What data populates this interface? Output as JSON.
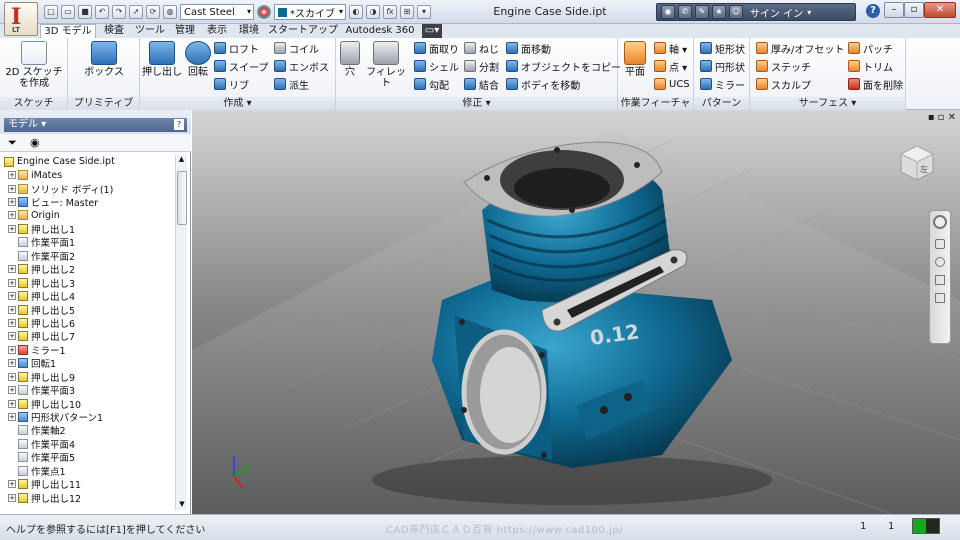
{
  "app": {
    "logo_letter": "I",
    "logo_sub": "LT",
    "doc_title": "Engine Case Side.ipt",
    "signin": "サイン イン",
    "help": "?"
  },
  "qat": {
    "material": "Cast Steel",
    "appearance": "*スカイブ",
    "fx": "fx"
  },
  "tabs": [
    "3D モデル",
    "検査",
    "ツール",
    "管理",
    "表示",
    "環境",
    "スタートアップ",
    "Autodesk 360"
  ],
  "ribbon": {
    "sketch": {
      "label": "スケッチ",
      "btn": [
        "2D スケッチ",
        "を作成"
      ]
    },
    "primitive": {
      "label": "プリミティブ",
      "btn": "ボックス"
    },
    "create": {
      "label": "作成 ▾",
      "extrude": "押し出し",
      "revolve": "回転",
      "loft": "ロフト",
      "sweep": "スイープ",
      "rib": "リブ",
      "coil": "コイル",
      "emboss": "エンボス",
      "derive": "派生"
    },
    "modify": {
      "label": "修正 ▾",
      "hole": "穴",
      "fillet": "フィレット",
      "chamfer": "面取り",
      "shell": "シェル",
      "draft": "勾配",
      "thread": "ねじ",
      "split": "分割",
      "combine": "結合",
      "face_move": "面移動",
      "copy_obj": "オブジェクトをコピー",
      "move_body": "ボディを移動"
    },
    "workfeature": {
      "label": "作業フィーチャ",
      "plane": "平面",
      "axis": "軸 ▾",
      "point": "点 ▾",
      "ucs": "UCS"
    },
    "pattern": {
      "label": "パターン",
      "rect": "矩形状",
      "circ": "円形状",
      "mirror": "ミラー"
    },
    "surface": {
      "label": "サーフェス ▾",
      "thicken": "厚み/オフセット",
      "stitch": "ステッチ",
      "sculpt": "スカルプ",
      "patch": "パッチ",
      "trim": "トリム",
      "delete_face": "面を削除"
    }
  },
  "browser": {
    "title": "モデル ▾",
    "items": [
      {
        "label": "Engine Case Side.ipt",
        "icon": "part",
        "expand": ""
      },
      {
        "label": "iMates",
        "icon": "folder",
        "expand": "+"
      },
      {
        "label": "ソリッド ボディ(1)",
        "icon": "folder",
        "expand": "+"
      },
      {
        "label": "ビュー: Master",
        "icon": "blue",
        "expand": "+"
      },
      {
        "label": "Origin",
        "icon": "folder",
        "expand": "+"
      },
      {
        "label": "押し出し1",
        "icon": "part",
        "expand": "+"
      },
      {
        "label": "作業平面1",
        "icon": "plane",
        "expand": ""
      },
      {
        "label": "作業平面2",
        "icon": "plane",
        "expand": ""
      },
      {
        "label": "押し出し2",
        "icon": "part",
        "expand": "+"
      },
      {
        "label": "押し出し3",
        "icon": "part",
        "expand": "+"
      },
      {
        "label": "押し出し4",
        "icon": "part",
        "expand": "+"
      },
      {
        "label": "押し出し5",
        "icon": "part",
        "expand": "+"
      },
      {
        "label": "押し出し6",
        "icon": "part",
        "expand": "+"
      },
      {
        "label": "押し出し7",
        "icon": "part",
        "expand": "+"
      },
      {
        "label": "ミラー1",
        "icon": "red",
        "expand": "+"
      },
      {
        "label": "回転1",
        "icon": "blue",
        "expand": "+"
      },
      {
        "label": "押し出し9",
        "icon": "part",
        "expand": "+"
      },
      {
        "label": "作業平面3",
        "icon": "plane",
        "expand": "+"
      },
      {
        "label": "押し出し10",
        "icon": "part",
        "expand": "+"
      },
      {
        "label": "円形状パターン1",
        "icon": "blue",
        "expand": "+"
      },
      {
        "label": "作業軸2",
        "icon": "plane",
        "expand": ""
      },
      {
        "label": "作業平面4",
        "icon": "plane",
        "expand": ""
      },
      {
        "label": "作業平面5",
        "icon": "plane",
        "expand": ""
      },
      {
        "label": "作業点1",
        "icon": "plane",
        "expand": ""
      },
      {
        "label": "押し出し11",
        "icon": "part",
        "expand": "+"
      },
      {
        "label": "押し出し12",
        "icon": "part",
        "expand": "+"
      }
    ]
  },
  "viewport": {
    "model_text": "0.12",
    "viewcube_label": "左"
  },
  "status": {
    "help_text": "ヘルプを参照するには[F1]を押してください",
    "watermark": "CAD専門店ＣＡＤ百貨 https://www.cad100.jp/",
    "count1": "1",
    "count2": "1"
  },
  "colors": {
    "model_blue": "#0f6a93",
    "ribbon_bg": "#f3f5f8",
    "status_green": "#13a81e"
  }
}
